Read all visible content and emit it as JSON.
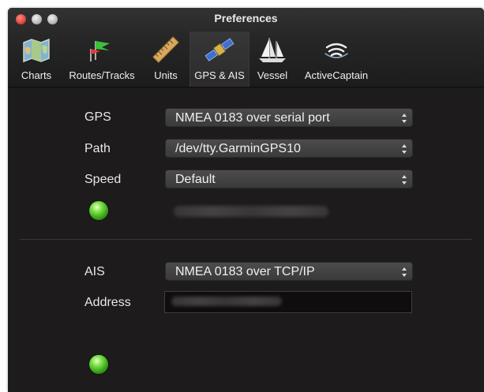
{
  "window": {
    "title": "Preferences"
  },
  "toolbar": {
    "items": [
      {
        "label": "Charts",
        "icon": "map-icon"
      },
      {
        "label": "Routes/Tracks",
        "icon": "route-flags-icon"
      },
      {
        "label": "Units",
        "icon": "ruler-icon"
      },
      {
        "label": "GPS & AIS",
        "icon": "satellite-icon",
        "selected": true
      },
      {
        "label": "Vessel",
        "icon": "sailboat-icon"
      },
      {
        "label": "ActiveCaptain",
        "icon": "wireless-waves-icon"
      }
    ]
  },
  "gps": {
    "label": "GPS",
    "value": "NMEA 0183 over serial port",
    "path_label": "Path",
    "path_value": "/dev/tty.GarminGPS10",
    "speed_label": "Speed",
    "speed_value": "Default",
    "status_color": "#4fc42a"
  },
  "ais": {
    "label": "AIS",
    "value": "NMEA 0183 over TCP/IP",
    "address_label": "Address",
    "status_color": "#4fc42a"
  }
}
